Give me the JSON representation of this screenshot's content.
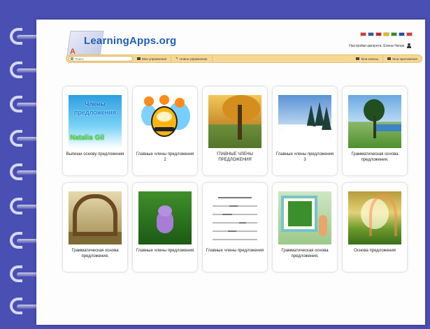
{
  "header": {
    "logo_text": "LearningApps.org",
    "logo_mark": "A",
    "flags": [
      "#d33",
      "#35a",
      "#c22",
      "#e9b800",
      "#2a8f2a",
      "#1c4fb0",
      "#e33"
    ],
    "user_text": "Настройки аккаунта: Елена Чепак",
    "user_icon": "user-icon"
  },
  "navbar": {
    "search_placeholder": "Поиск",
    "my_exercises": "Мои упражнения",
    "new_exercise": "Новое упражнение",
    "my_classes": "Мои классы",
    "my_apps": "Мои приложения"
  },
  "cards": [
    {
      "caption": "Выпиши основу предложения",
      "thumb_text_1": "Члены",
      "thumb_text_2": "предложения",
      "thumb_text_3": "Natalia Gil"
    },
    {
      "caption": "Главные члены предложения 2"
    },
    {
      "caption": "ГЛАВНЫЕ ЧЛЕНЫ ПРЕДЛОЖЕНИЯ"
    },
    {
      "caption": "Главные члены предложения 3"
    },
    {
      "caption": "Грамматическая основа предложения."
    },
    {
      "caption": "Грамматическая основа предложения."
    },
    {
      "caption": "Главные члены предложения"
    },
    {
      "caption": "Главные члены предложения"
    },
    {
      "caption": "Грамматическая основа предложения."
    },
    {
      "caption": "Основа предложения"
    }
  ]
}
